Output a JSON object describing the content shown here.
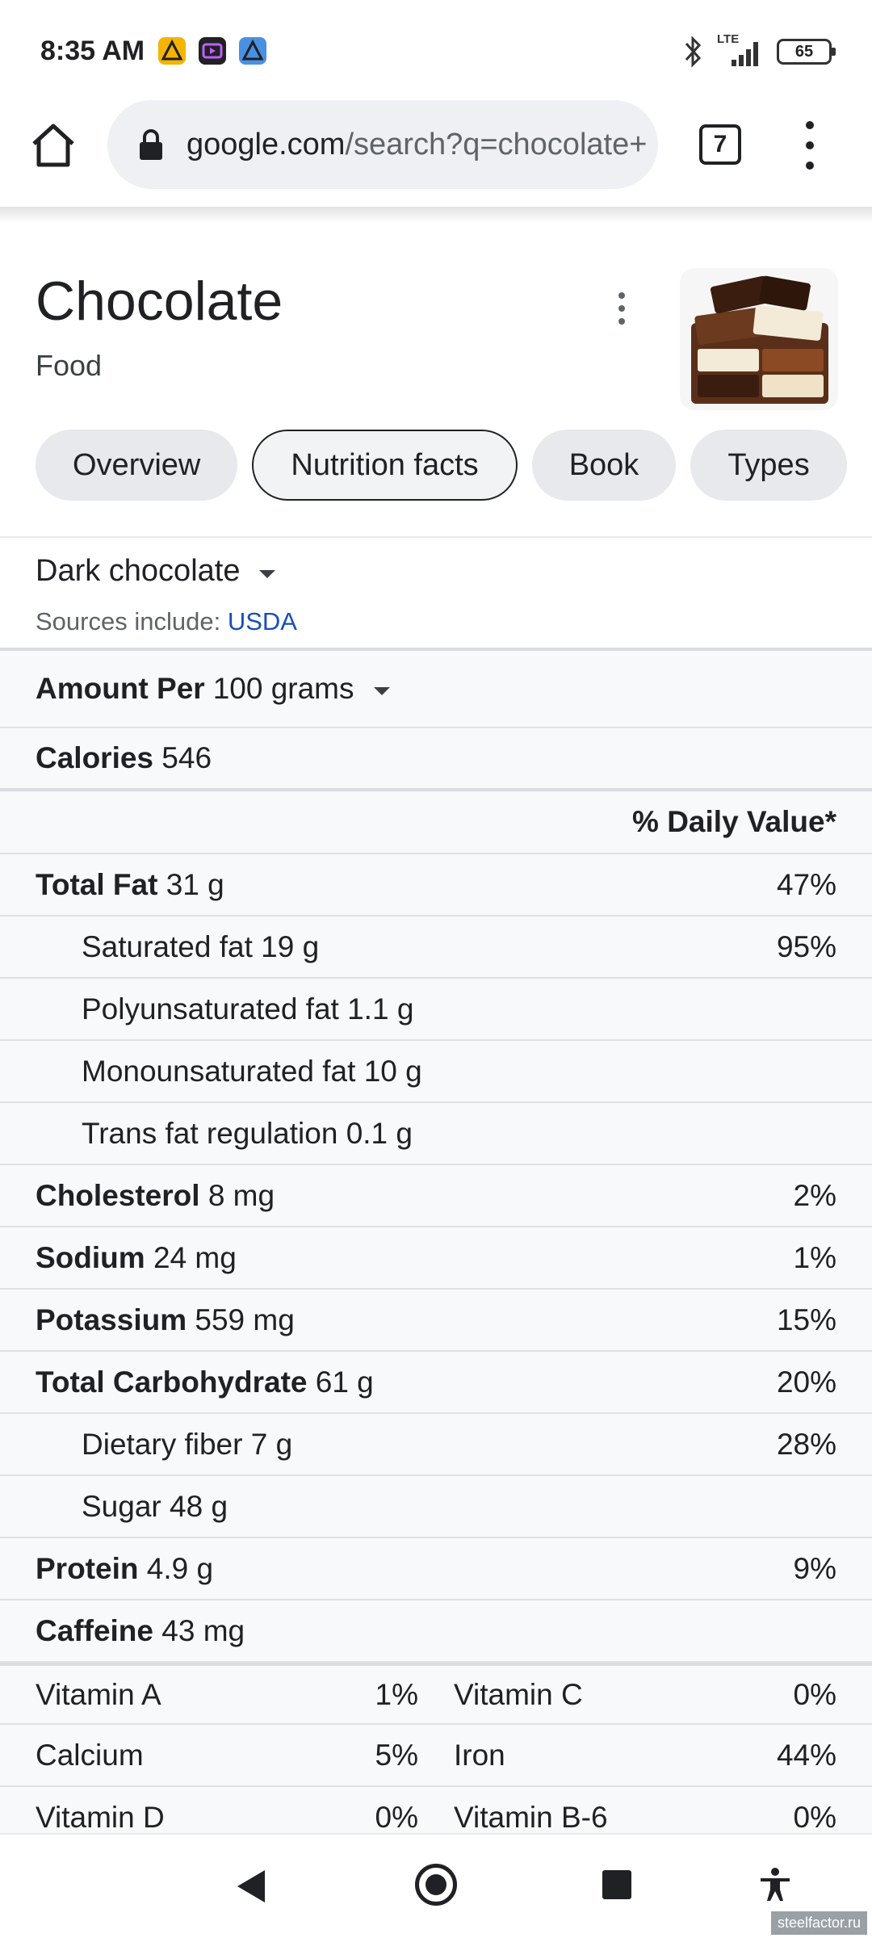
{
  "status_bar": {
    "time": "8:35 AM",
    "network": "LTE",
    "battery": "65"
  },
  "browser": {
    "url_domain": "google.com",
    "url_path": "/search?q=chocolate+",
    "tab_count": "7"
  },
  "knowledge_panel": {
    "title": "Chocolate",
    "subtitle": "Food",
    "chips": [
      "Overview",
      "Nutrition facts",
      "Book",
      "Types"
    ],
    "selected_chip": "Nutrition facts"
  },
  "nutrition": {
    "variety": "Dark chocolate",
    "sources_label": "Sources include: ",
    "sources_link": "USDA",
    "amount_label": "Amount Per",
    "amount_value": "100 grams",
    "calories_label": "Calories",
    "calories_value": "546",
    "daily_value_header": "% Daily Value*",
    "rows": [
      {
        "label": "Total Fat",
        "amount": "31 g",
        "dv": "47%"
      },
      {
        "label": "Saturated fat",
        "amount": "19 g",
        "dv": "95%"
      },
      {
        "label": "Polyunsaturated fat",
        "amount": "1.1 g",
        "dv": ""
      },
      {
        "label": "Monounsaturated fat",
        "amount": "10 g",
        "dv": ""
      },
      {
        "label": "Trans fat regulation",
        "amount": "0.1 g",
        "dv": ""
      },
      {
        "label": "Cholesterol",
        "amount": "8 mg",
        "dv": "2%"
      },
      {
        "label": "Sodium",
        "amount": "24 mg",
        "dv": "1%"
      },
      {
        "label": "Potassium",
        "amount": "559 mg",
        "dv": "15%"
      },
      {
        "label": "Total Carbohydrate",
        "amount": "61 g",
        "dv": "20%"
      },
      {
        "label": "Dietary fiber",
        "amount": "7 g",
        "dv": "28%"
      },
      {
        "label": "Sugar",
        "amount": "48 g",
        "dv": ""
      },
      {
        "label": "Protein",
        "amount": "4.9 g",
        "dv": "9%"
      },
      {
        "label": "Caffeine",
        "amount": "43 mg",
        "dv": ""
      }
    ],
    "vitamins": [
      {
        "name": "Vitamin A",
        "value": "1%"
      },
      {
        "name": "Vitamin C",
        "value": "0%"
      },
      {
        "name": "Calcium",
        "value": "5%"
      },
      {
        "name": "Iron",
        "value": "44%"
      },
      {
        "name": "Vitamin D",
        "value": "0%"
      },
      {
        "name": "Vitamin B-6",
        "value": "0%"
      }
    ]
  },
  "watermark": "steelfactor.ru",
  "colors": {
    "link": "#1a4fb5",
    "chip_bg": "#e8e9ec",
    "table_bg": "#f8f9fa"
  }
}
